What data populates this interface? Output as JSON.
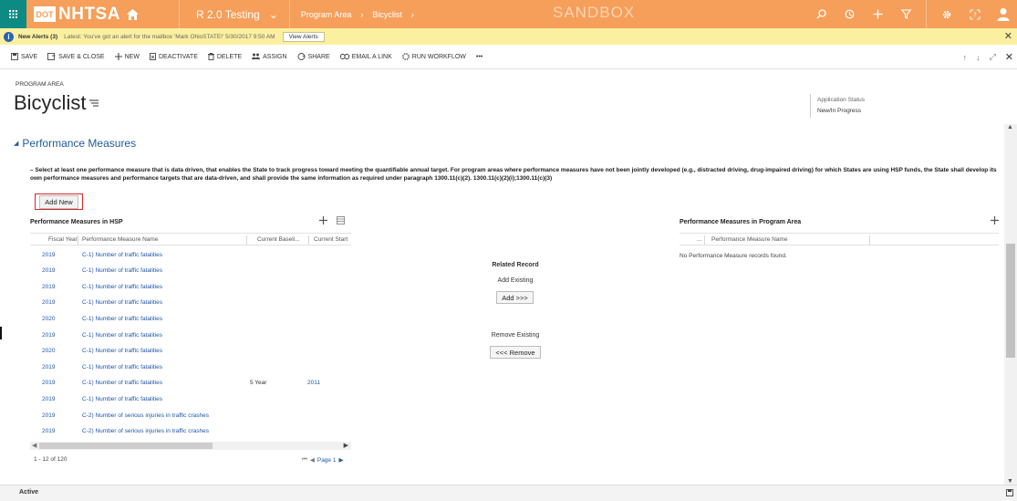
{
  "app": {
    "brand": "NHTSA",
    "brand_mark": "DOT",
    "module": "R 2.0 Testing",
    "breadcrumb_area": "Program Area",
    "breadcrumb_record": "Bicyclist",
    "environment": "SANDBOX"
  },
  "alert": {
    "title": "New Alerts (3)",
    "message": "Latest: You've got an alert for the mailbox 'Mark OhioSTATE!' 5/30/2017 9:50 AM",
    "button": "View Alerts"
  },
  "commands": {
    "save": "SAVE",
    "save_close": "SAVE & CLOSE",
    "new": "NEW",
    "deactivate": "DEACTIVATE",
    "delete": "DELETE",
    "assign": "ASSIGN",
    "share": "SHARE",
    "email_link": "EMAIL A LINK",
    "run_workflow": "RUN WORKFLOW",
    "more": "•••"
  },
  "header": {
    "entity_type": "PROGRAM AREA",
    "title": "Bicyclist",
    "status_label": "Application Status",
    "status_value": "New/In Progress"
  },
  "section": {
    "title": "Performance Measures",
    "instructions": "– Select at least one performance measure that is data driven, that enables the State to track progress toward meeting the quantifiable annual target. For program areas where performance measures have not been jointly developed (e.g., distracted driving, drug-impaired driving) for which States are using HSP funds, the State shall develop its own performance measures and performance targets that are data-driven, and shall provide the same information as required under paragraph 1300.11(c)(2). 1300.11(c)(2)(i);1300.11(c)(3)",
    "add_new": "Add New"
  },
  "hsp_grid": {
    "title": "Performance Measures in HSP",
    "columns": {
      "fiscal_year": "Fiscal Year",
      "measure_name": "Performance Measure Name",
      "baseline": "Current Baseli...",
      "start": "Current Start"
    },
    "rows": [
      {
        "year": "2019",
        "name": "C-1) Number of traffic fatalities",
        "baseline": "",
        "start": ""
      },
      {
        "year": "2019",
        "name": "C-1) Number of traffic fatalities",
        "baseline": "",
        "start": ""
      },
      {
        "year": "2019",
        "name": "C-1) Number of traffic fatalities",
        "baseline": "",
        "start": ""
      },
      {
        "year": "2019",
        "name": "C-1) Number of traffic fatalities",
        "baseline": "",
        "start": ""
      },
      {
        "year": "2020",
        "name": "C-1) Number of traffic fatalities",
        "baseline": "",
        "start": ""
      },
      {
        "year": "2019",
        "name": "C-1) Number of traffic fatalities",
        "baseline": "",
        "start": ""
      },
      {
        "year": "2020",
        "name": "C-1) Number of traffic fatalities",
        "baseline": "",
        "start": ""
      },
      {
        "year": "2019",
        "name": "C-1) Number of traffic fatalities",
        "baseline": "",
        "start": ""
      },
      {
        "year": "2019",
        "name": "C-1) Number of traffic fatalities",
        "baseline": "5 Year",
        "start": "2011"
      },
      {
        "year": "2019",
        "name": "C-1) Number of traffic fatalities",
        "baseline": "",
        "start": ""
      },
      {
        "year": "2019",
        "name": "C-2) Number of serious injuries in traffic crashes",
        "baseline": "",
        "start": ""
      },
      {
        "year": "2019",
        "name": "C-2) Number of serious injuries in traffic crashes",
        "baseline": "",
        "start": ""
      }
    ],
    "record_count": "1 - 12 of 120",
    "page_label": "Page 1"
  },
  "related": {
    "title": "Related Record",
    "add_existing": "Add Existing",
    "add_button": "Add >>>",
    "remove_existing": "Remove Existing",
    "remove_button": "<<< Remove"
  },
  "area_grid": {
    "title": "Performance Measures in Program Area",
    "col_ellipsis": "...",
    "col_name": "Performance Measure Name",
    "empty": "No Performance Measure records found."
  },
  "footer": {
    "status": "Active"
  },
  "colors": {
    "topbar": "#f59f5a",
    "waffle": "#0e8a84",
    "alert_bg": "#fbf0a0",
    "link": "#1f56a8",
    "section_title": "#1e5c9a",
    "highlight_border": "#d7262a"
  }
}
